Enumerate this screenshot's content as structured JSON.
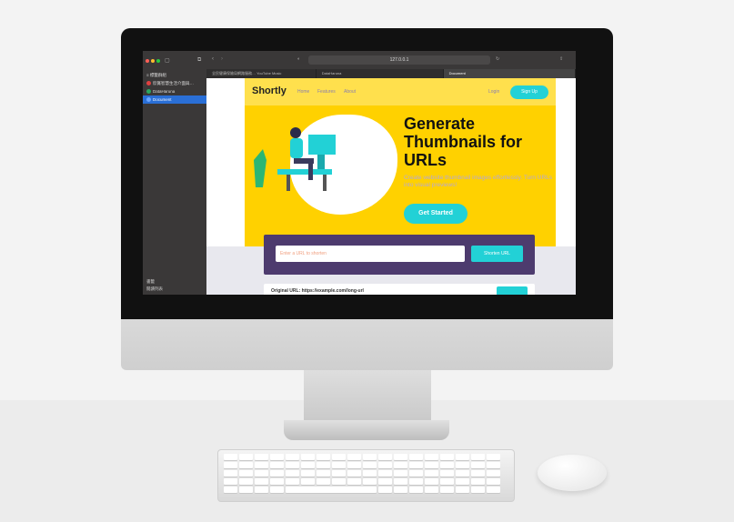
{
  "browser": {
    "address": "127.0.0.1",
    "sidebar": {
      "header": "≡ 標籤群組",
      "items": [
        {
          "label": "欣賞智慧生活介面與…",
          "color": "#e04040",
          "active": false
        },
        {
          "label": "DataHaruna",
          "color": "#2aa860",
          "active": false
        },
        {
          "label": "Document",
          "color": "#6aa6ff",
          "active": true
        }
      ],
      "bottom": [
        "書籤",
        "閱讀列表"
      ]
    },
    "tabs": [
      {
        "label": "全民健康保險局網路服務…  YouTube Music",
        "active": false
      },
      {
        "label": "DataHaruna",
        "active": false
      },
      {
        "label": "Document",
        "active": true
      }
    ]
  },
  "site": {
    "logo": "Shortly",
    "nav": [
      "Home",
      "Features",
      "About"
    ],
    "login": "Login",
    "signup": "Sign Up",
    "hero_title": "Generate Thumbnails for URLs",
    "hero_sub": "Create website thumbnail images effortlessly. Turn URLs into visual previews!",
    "cta": "Get Started",
    "input_placeholder": "Enter a URL to shorten",
    "shorten_button": "Shorten URL",
    "card_text": "Original URL: https://example.com/long-url"
  },
  "colors": {
    "brand_yellow": "#ffd100",
    "accent_cyan": "#22d1d6",
    "form_purple": "#4d3b6e"
  }
}
